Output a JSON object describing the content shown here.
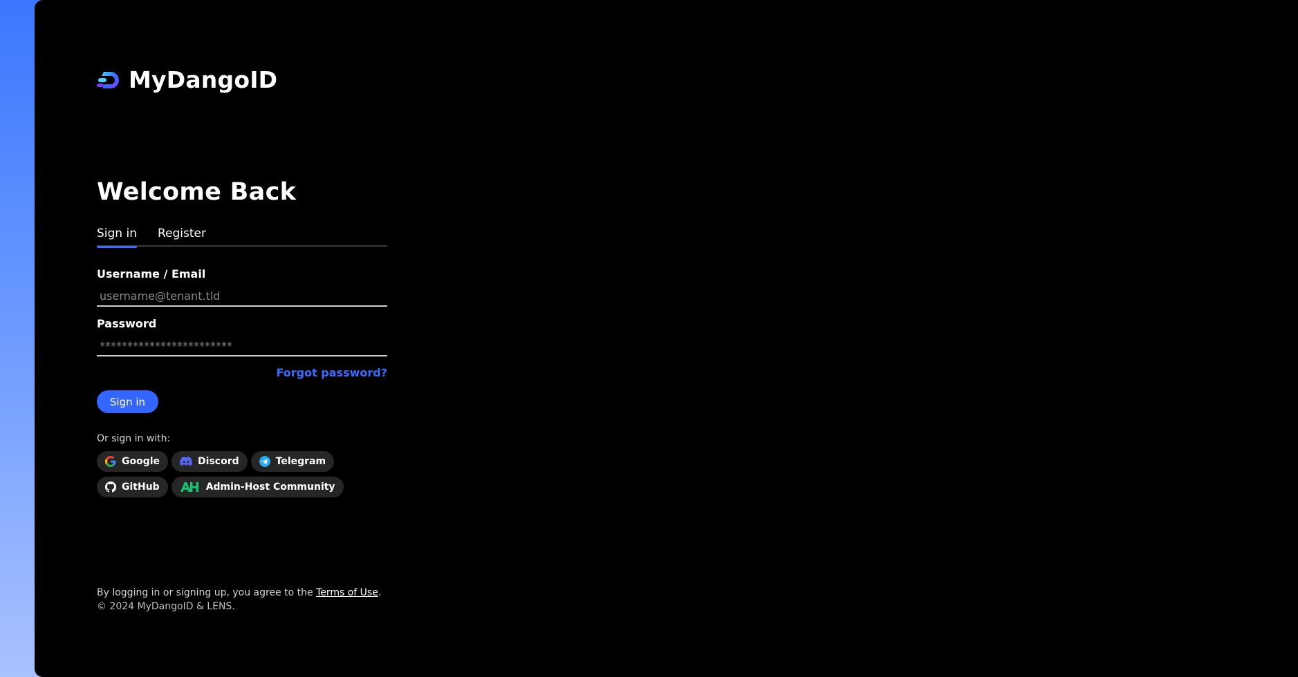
{
  "brand": {
    "name": "MyDangoID"
  },
  "page": {
    "title": "Welcome Back"
  },
  "tabs": [
    {
      "label": "Sign in",
      "active": true
    },
    {
      "label": "Register",
      "active": false
    }
  ],
  "form": {
    "username_label": "Username / Email",
    "username_placeholder": "username@tenant.tld",
    "password_label": "Password",
    "password_placeholder": "************************",
    "forgot_label": "Forgot password?",
    "submit_label": "Sign in"
  },
  "social": {
    "label": "Or sign in with:",
    "providers": [
      {
        "name": "Google",
        "icon": "google-icon"
      },
      {
        "name": "Discord",
        "icon": "discord-icon"
      },
      {
        "name": "Telegram",
        "icon": "telegram-icon"
      },
      {
        "name": "GitHub",
        "icon": "github-icon"
      },
      {
        "name": "Admin-Host Community",
        "icon": "admin-host-icon"
      }
    ]
  },
  "legal": {
    "prefix": "By logging in or signing up, you agree to the ",
    "link": "Terms of Use",
    "suffix": ".",
    "copyright": "© 2024 MyDangoID & LENS."
  },
  "colors": {
    "accent": "#3466ff",
    "background": "#000000",
    "chip": "#262626"
  }
}
